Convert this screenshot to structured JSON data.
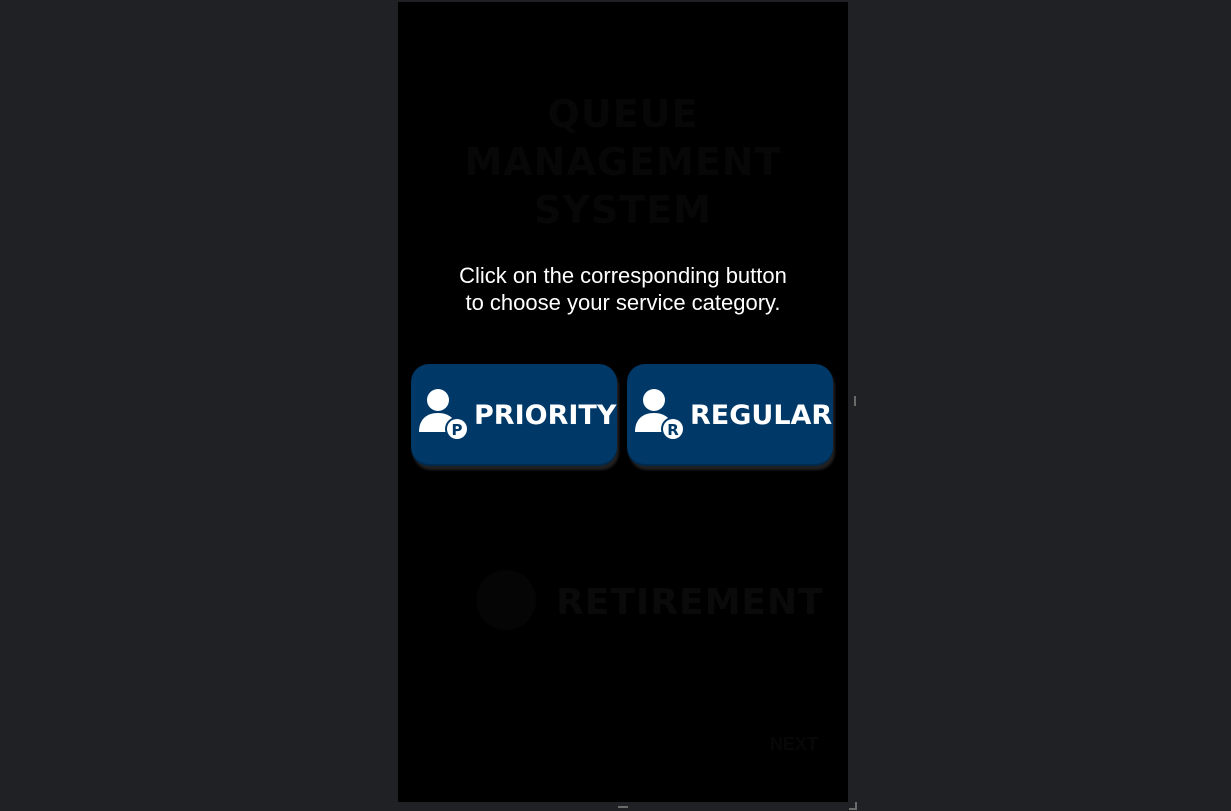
{
  "background": {
    "faint_title_line1": "QUEUE MANAGEMENT",
    "faint_title_line2": "SYSTEM",
    "faint_retirement_label": "RETIREMENT",
    "faint_footer": "NEXT"
  },
  "prompt": {
    "line1": "Click on the corresponding button",
    "line2": "to choose your service category."
  },
  "buttons": [
    {
      "label": "PRIORITY",
      "badge": "P",
      "icon": "person-priority-icon"
    },
    {
      "label": "REGULAR",
      "badge": "R",
      "icon": "person-regular-icon"
    }
  ],
  "colors": {
    "page_background": "#202124",
    "kiosk_background": "#000000",
    "button_background": "#003868",
    "button_text": "#ffffff",
    "prompt_text": "#ffffff"
  }
}
